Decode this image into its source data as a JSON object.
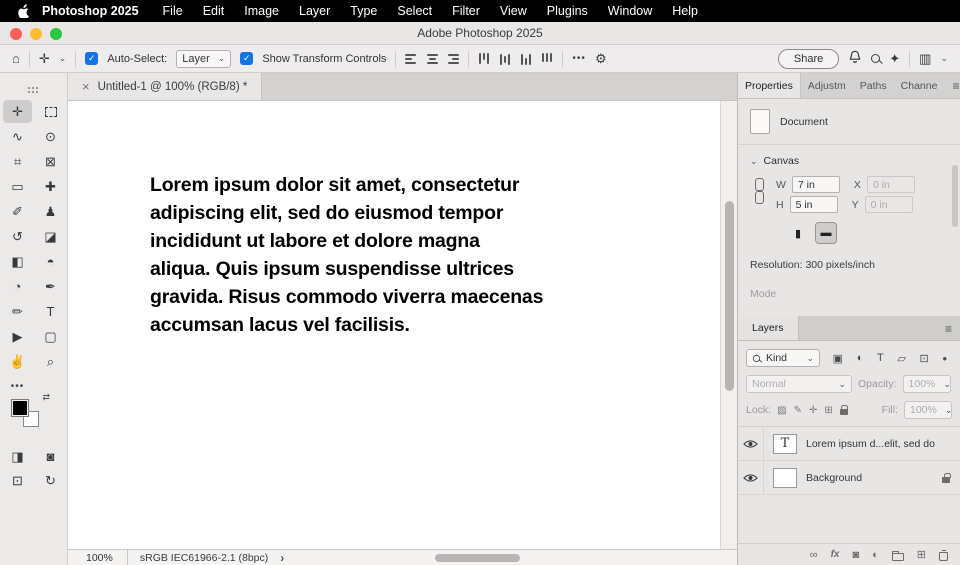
{
  "menu_bar": {
    "app_name": "Photoshop 2025",
    "items": [
      "File",
      "Edit",
      "Image",
      "Layer",
      "Type",
      "Select",
      "Filter",
      "View",
      "Plugins",
      "Window",
      "Help"
    ]
  },
  "title_bar": {
    "title": "Adobe Photoshop 2025"
  },
  "options_bar": {
    "auto_select_label": "Auto-Select:",
    "auto_select_value": "Layer",
    "show_transform_label": "Show Transform Controls",
    "share_label": "Share",
    "check_glyph": "✓"
  },
  "document_tab": {
    "close_glyph": "×",
    "title": "Untitled-1 @ 100% (RGB/8) *"
  },
  "left_toolbar": {
    "more_glyph": "•••",
    "swap_glyph": "⇄",
    "tools": [
      {
        "name": "move-tool",
        "glyph": "✛",
        "selected": true
      },
      {
        "name": "rectangular-marquee-tool",
        "dashed": true
      },
      {
        "name": "lasso-tool",
        "glyph": "∿"
      },
      {
        "name": "object-selection-tool",
        "glyph": "⊙"
      },
      {
        "name": "crop-tool",
        "glyph": "⌗"
      },
      {
        "name": "frame-tool",
        "glyph": "⊠"
      },
      {
        "name": "eyedropper-tool",
        "glyph": "▭"
      },
      {
        "name": "healing-brush-tool",
        "glyph": "✚"
      },
      {
        "name": "brush-tool",
        "glyph": "✐"
      },
      {
        "name": "clone-stamp-tool",
        "glyph": "♟"
      },
      {
        "name": "history-brush-tool",
        "glyph": "↺"
      },
      {
        "name": "eraser-tool",
        "glyph": "◪"
      },
      {
        "name": "gradient-tool",
        "glyph": "◧"
      },
      {
        "name": "smudge-tool",
        "glyph": "◓"
      },
      {
        "name": "dodge-tool",
        "glyph": "◔"
      },
      {
        "name": "pen-tool",
        "glyph": "✒"
      },
      {
        "name": "pencil-tool",
        "glyph": "✏"
      },
      {
        "name": "type-tool",
        "glyph": "T"
      },
      {
        "name": "path-selection-tool",
        "glyph": "▶"
      },
      {
        "name": "rectangle-tool",
        "glyph": "▢"
      },
      {
        "name": "hand-tool",
        "glyph": "✌"
      },
      {
        "name": "zoom-tool",
        "glyph": "⌕"
      }
    ],
    "extra_tools": [
      {
        "name": "edit-toolbar-button",
        "glyph": "◨"
      },
      {
        "name": "quick-mask-button",
        "glyph": "◙"
      },
      {
        "name": "screen-mode-button",
        "glyph": "⊡"
      },
      {
        "name": "rotate-view-button",
        "glyph": "↻"
      }
    ]
  },
  "canvas_document": {
    "text_lines": [
      "Lorem ipsum dolor sit amet, consectetur",
      "adipiscing elit, sed do eiusmod tempor",
      "incididunt ut labore et dolore magna",
      "aliqua. Quis ipsum suspendisse ultrices",
      "gravida. Risus commodo viverra maecenas",
      "accumsan lacus vel facilisis."
    ]
  },
  "status_bar": {
    "zoom": "100%",
    "profile": "sRGB IEC61966-2.1 (8bpc)",
    "chevron": "›"
  },
  "properties_panel": {
    "tabs": [
      {
        "label": "Properties",
        "active": true
      },
      {
        "label": "Adjustm",
        "active": false
      },
      {
        "label": "Paths",
        "active": false
      },
      {
        "label": "Channe",
        "active": false
      }
    ],
    "panel_menu_glyph": "≡",
    "document_label": "Document",
    "canvas_section": {
      "header": "Canvas",
      "chevron": "⌄",
      "w_label": "W",
      "w_value": "7 in",
      "x_label": "X",
      "x_value": "0 in",
      "h_label": "H",
      "h_value": "5 in",
      "y_label": "Y",
      "y_value": "0 in",
      "portrait_glyph": "▮",
      "landscape_glyph": "▬",
      "resolution": "Resolution: 300 pixels/inch",
      "mode_label": "Mode"
    }
  },
  "layers_panel": {
    "tab_label": "Layers",
    "panel_menu_glyph": "≡",
    "kind_label": "Kind",
    "filter_icons": [
      {
        "name": "filter-pixel-layers-icon",
        "glyph": "▣"
      },
      {
        "name": "filter-adjustment-layers-icon",
        "glyph": "◐"
      },
      {
        "name": "filter-type-layers-icon",
        "glyph": "T"
      },
      {
        "name": "filter-shape-layers-icon",
        "glyph": "▱"
      },
      {
        "name": "filter-smart-objects-icon",
        "glyph": "⊡"
      },
      {
        "name": "filter-toggle-icon",
        "glyph": "●"
      }
    ],
    "blend_mode": "Normal",
    "opacity_label": "Opacity:",
    "opacity_value": "100%",
    "lock_label": "Lock:",
    "lock_icons": [
      {
        "name": "lock-transparency-icon",
        "glyph": "▨"
      },
      {
        "name": "lock-pixels-icon",
        "glyph": "✎"
      },
      {
        "name": "lock-position-icon",
        "glyph": "✛"
      },
      {
        "name": "lock-artboard-icon",
        "glyph": "⊞"
      },
      {
        "name": "lock-all-icon",
        "glyph": "css-lock"
      }
    ],
    "fill_label": "Fill:",
    "fill_value": "100%",
    "layers": [
      {
        "name": "Lorem ipsum d...elit, sed do",
        "thumb": "T",
        "locked": false,
        "visible": true
      },
      {
        "name": "Background",
        "thumb": "",
        "locked": true,
        "visible": true
      }
    ],
    "bottom_icons": [
      {
        "name": "link-layers-icon",
        "glyph": "∞"
      },
      {
        "name": "layer-effects-icon",
        "glyph": "fx"
      },
      {
        "name": "layer-mask-icon",
        "glyph": "◙"
      },
      {
        "name": "adjustment-layer-icon",
        "glyph": "◐"
      },
      {
        "name": "layer-group-icon",
        "glyph": "css-folder"
      },
      {
        "name": "new-layer-icon",
        "glyph": "⊞"
      },
      {
        "name": "delete-layer-icon",
        "glyph": "css-trash"
      }
    ]
  },
  "icons": {
    "home": "⌂",
    "move": "✛",
    "caret": "⌄",
    "gear": "⚙",
    "more": "•••",
    "ai": "✦",
    "panel": "▥"
  }
}
